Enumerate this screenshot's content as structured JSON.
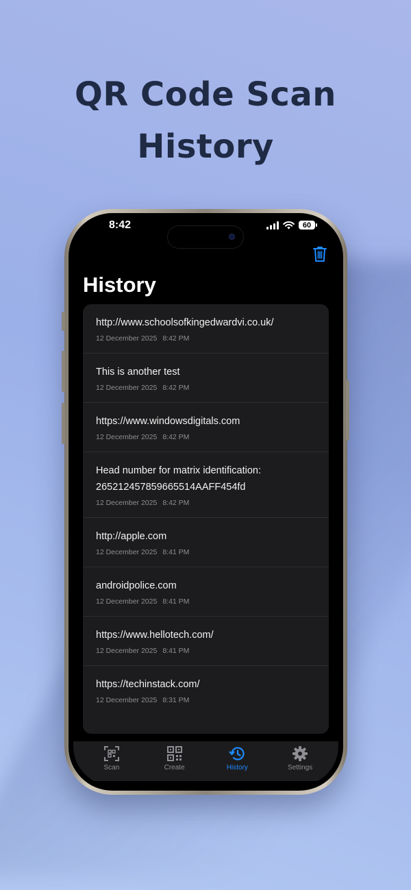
{
  "promo": {
    "headline_line1": "QR Code Scan",
    "headline_line2": "History"
  },
  "status_bar": {
    "time": "8:42",
    "battery": "60"
  },
  "nav": {
    "title": "History",
    "trash_icon": "trash-icon"
  },
  "history": {
    "items": [
      {
        "text": "http://www.schoolsofkingedwardvi.co.uk/",
        "date": "12 December 2025",
        "time": "8:42 PM"
      },
      {
        "text": "This is another test",
        "date": "12 December 2025",
        "time": "8:42 PM"
      },
      {
        "text": "https://www.windowsdigitals.com",
        "date": "12 December 2025",
        "time": "8:42 PM"
      },
      {
        "text_line1": "Head number for matrix identification:",
        "text_line2": "265212457859665514AAFF454fd",
        "date": "12 December 2025",
        "time": "8:42 PM"
      },
      {
        "text": "http://apple.com",
        "date": "12 December 2025",
        "time": "8:41 PM"
      },
      {
        "text": "androidpolice.com",
        "date": "12 December 2025",
        "time": "8:41 PM"
      },
      {
        "text": "https://www.hellotech.com/",
        "date": "12 December 2025",
        "time": "8:41 PM"
      },
      {
        "text": "https://techinstack.com/",
        "date": "12 December 2025",
        "time": "8:31 PM"
      }
    ]
  },
  "tabs": [
    {
      "label": "Scan",
      "icon": "scan-icon"
    },
    {
      "label": "Create",
      "icon": "qr-code-icon"
    },
    {
      "label": "History",
      "icon": "history-icon",
      "active": true
    },
    {
      "label": "Settings",
      "icon": "gear-icon"
    }
  ],
  "colors": {
    "accent": "#1e8bff",
    "background": "#000000",
    "card": "#1c1c1e",
    "headline": "#1f2a44"
  }
}
